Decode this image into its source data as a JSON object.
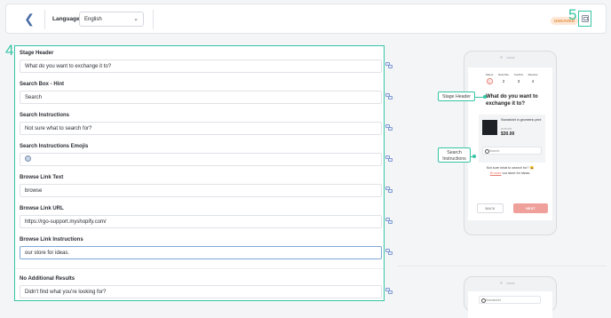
{
  "topbar": {
    "language_label": "Language",
    "language_value": "English",
    "status_badge": "UNSAVED",
    "annotation_number": "5"
  },
  "form": {
    "annotation_number": "4",
    "fields": [
      {
        "label": "Stage Header",
        "value": "What do you want to exchange it to?"
      },
      {
        "label": "Search Box - Hint",
        "value": "Search"
      },
      {
        "label": "Search Instructions",
        "value": "Not sure what to search for?"
      },
      {
        "label": "Search Instructions Emojis",
        "value": ""
      },
      {
        "label": "Browse Link Text",
        "value": "browse"
      },
      {
        "label": "Browse Link URL",
        "value": "https://rgo-support.myshopify.com/"
      },
      {
        "label": "Browse Link Instructions",
        "value": "our store for ideas."
      },
      {
        "label": "No Additional Results",
        "value": "Didn't find what you're looking for?"
      }
    ]
  },
  "preview": {
    "steps": [
      {
        "name": "Select",
        "n": "1"
      },
      {
        "name": "Describe",
        "n": "2"
      },
      {
        "name": "Confirm",
        "n": "3"
      },
      {
        "name": "Resolve",
        "n": "4"
      }
    ],
    "stage_header": "What do you want to exchange it to?",
    "product_name": "Sweatshirt in geometric print",
    "product_sku": "#0451156",
    "product_price": "$30.00",
    "search_hint": "Search",
    "search_instructions": "Not sure what to search for?",
    "browse_link": "Browse",
    "browse_rest": " our store for ideas.",
    "back_button": "BACK",
    "next_button": "NEXT",
    "callout_stage_header": "Stage Header",
    "callout_search_instructions": "Search Instructions",
    "second_search": "Sweatshirt"
  },
  "colors": {
    "annotation": "#36c5a6",
    "accent": "#e97b6f",
    "badge_bg": "#fde7d6",
    "badge_text": "#e38b3c"
  }
}
